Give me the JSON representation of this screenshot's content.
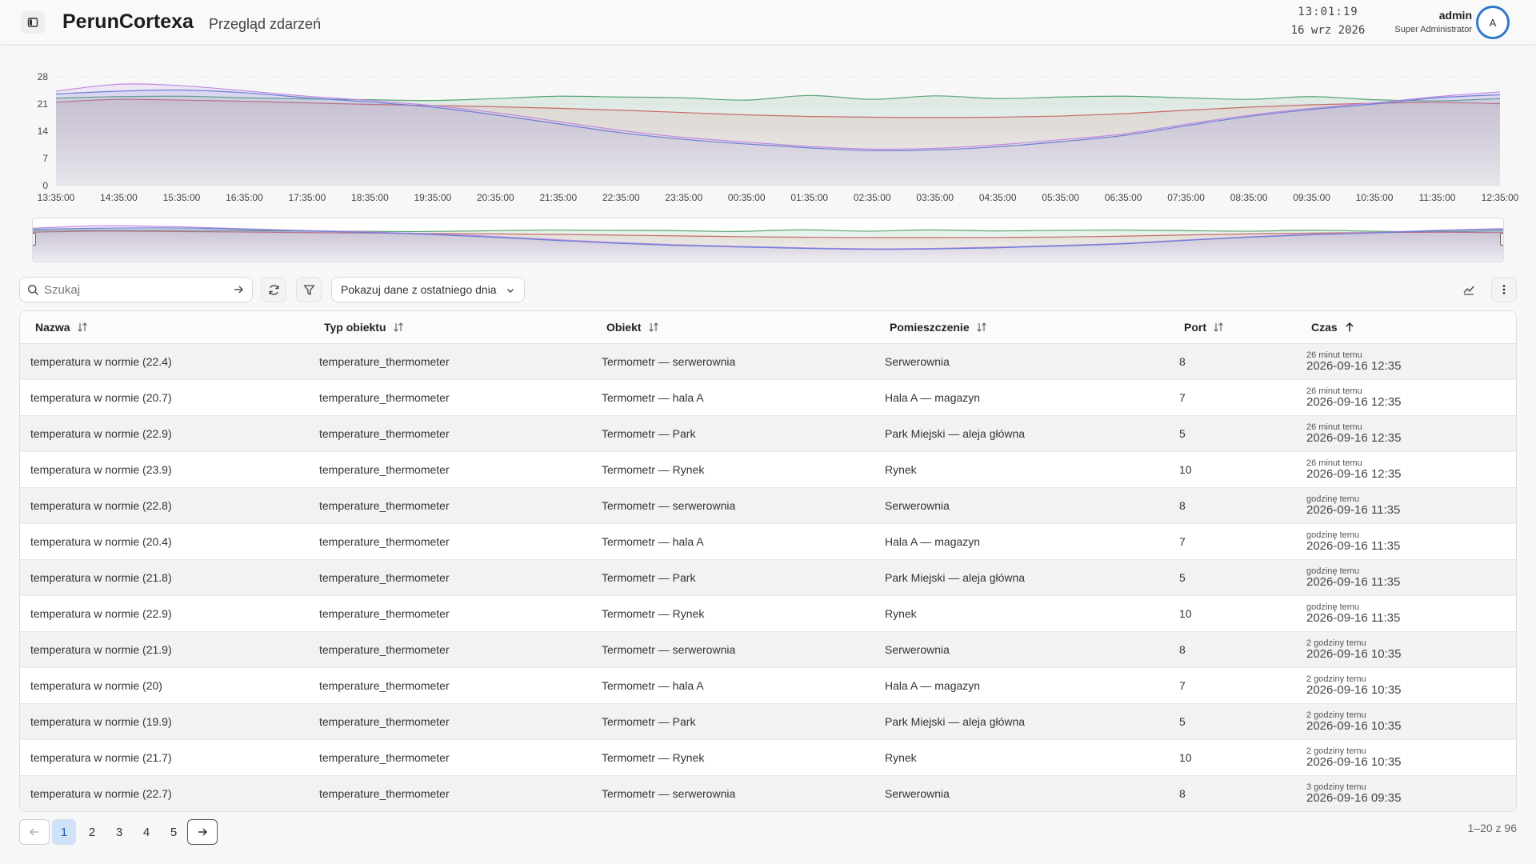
{
  "header": {
    "app_title": "PerunCortexa",
    "page_subtitle": "Przegląd zdarzeń",
    "time": "13:01:19",
    "date": "16 wrz 2026",
    "user_name": "admin",
    "user_role": "Super Administrator",
    "avatar_letter": "A"
  },
  "chart_data": {
    "type": "area",
    "title": "",
    "xlabel": "",
    "ylabel": "",
    "ylim": [
      0,
      28
    ],
    "yticks": [
      0,
      7,
      14,
      21,
      28
    ],
    "grid": "horizontal",
    "categories": [
      "13:35:00",
      "14:35:00",
      "15:35:00",
      "16:35:00",
      "17:35:00",
      "18:35:00",
      "19:35:00",
      "20:35:00",
      "21:35:00",
      "22:35:00",
      "23:35:00",
      "00:35:00",
      "01:35:00",
      "02:35:00",
      "03:35:00",
      "04:35:00",
      "05:35:00",
      "06:35:00",
      "07:35:00",
      "08:35:00",
      "09:35:00",
      "10:35:00",
      "11:35:00",
      "12:35:00"
    ],
    "series": [
      {
        "color": "#5aa576",
        "values": [
          22.5,
          22.9,
          23.0,
          22.6,
          22.3,
          22.1,
          21.9,
          22.4,
          23.0,
          22.8,
          22.6,
          22.0,
          23.2,
          22.2,
          23.1,
          22.4,
          22.8,
          23.0,
          22.6,
          22.2,
          22.9,
          22.1,
          21.8,
          22.4
        ]
      },
      {
        "color": "#c66a6a",
        "values": [
          21.5,
          22.2,
          22.0,
          21.7,
          21.3,
          20.9,
          20.6,
          20.3,
          19.9,
          19.4,
          18.8,
          18.2,
          17.8,
          17.6,
          17.5,
          17.6,
          17.9,
          18.5,
          19.4,
          20.2,
          20.8,
          21.2,
          21.4,
          21.1
        ]
      },
      {
        "color": "#c08be0",
        "values": [
          24.3,
          26.1,
          25.7,
          24.4,
          23.0,
          21.9,
          20.6,
          18.8,
          16.5,
          14.2,
          12.4,
          11.2,
          10.1,
          9.4,
          9.6,
          10.5,
          11.8,
          13.3,
          15.8,
          18.1,
          19.9,
          21.3,
          22.9,
          24.1
        ]
      },
      {
        "color": "#6b7fd6",
        "values": [
          23.6,
          24.3,
          24.6,
          23.9,
          22.6,
          21.5,
          20.2,
          18.2,
          15.9,
          13.6,
          11.9,
          10.7,
          9.7,
          9.0,
          9.2,
          10.0,
          11.3,
          12.9,
          15.4,
          17.8,
          19.6,
          21.0,
          22.6,
          23.4
        ]
      }
    ]
  },
  "toolbar": {
    "search_placeholder": "Szukaj",
    "range_label": "Pokazuj dane z ostatniego dnia"
  },
  "table": {
    "columns": [
      "Nazwa",
      "Typ obiektu",
      "Obiekt",
      "Pomieszczenie",
      "Port",
      "Czas"
    ],
    "rows": [
      {
        "name": "temperatura w normie (22.4)",
        "type": "temperature_thermometer",
        "object": "Termometr — serwerownia",
        "room": "Serwerownia",
        "port": "8",
        "rel": "26 minut temu",
        "abs": "2026-09-16 12:35"
      },
      {
        "name": "temperatura w normie (20.7)",
        "type": "temperature_thermometer",
        "object": "Termometr — hala A",
        "room": "Hala A — magazyn",
        "port": "7",
        "rel": "26 minut temu",
        "abs": "2026-09-16 12:35"
      },
      {
        "name": "temperatura w normie (22.9)",
        "type": "temperature_thermometer",
        "object": "Termometr — Park",
        "room": "Park Miejski — aleja główna",
        "port": "5",
        "rel": "26 minut temu",
        "abs": "2026-09-16 12:35"
      },
      {
        "name": "temperatura w normie (23.9)",
        "type": "temperature_thermometer",
        "object": "Termometr — Rynek",
        "room": "Rynek",
        "port": "10",
        "rel": "26 minut temu",
        "abs": "2026-09-16 12:35"
      },
      {
        "name": "temperatura w normie (22.8)",
        "type": "temperature_thermometer",
        "object": "Termometr — serwerownia",
        "room": "Serwerownia",
        "port": "8",
        "rel": "godzinę temu",
        "abs": "2026-09-16 11:35"
      },
      {
        "name": "temperatura w normie (20.4)",
        "type": "temperature_thermometer",
        "object": "Termometr — hala A",
        "room": "Hala A — magazyn",
        "port": "7",
        "rel": "godzinę temu",
        "abs": "2026-09-16 11:35"
      },
      {
        "name": "temperatura w normie (21.8)",
        "type": "temperature_thermometer",
        "object": "Termometr — Park",
        "room": "Park Miejski — aleja główna",
        "port": "5",
        "rel": "godzinę temu",
        "abs": "2026-09-16 11:35"
      },
      {
        "name": "temperatura w normie (22.9)",
        "type": "temperature_thermometer",
        "object": "Termometr — Rynek",
        "room": "Rynek",
        "port": "10",
        "rel": "godzinę temu",
        "abs": "2026-09-16 11:35"
      },
      {
        "name": "temperatura w normie (21.9)",
        "type": "temperature_thermometer",
        "object": "Termometr — serwerownia",
        "room": "Serwerownia",
        "port": "8",
        "rel": "2 godziny temu",
        "abs": "2026-09-16 10:35"
      },
      {
        "name": "temperatura w normie (20)",
        "type": "temperature_thermometer",
        "object": "Termometr — hala A",
        "room": "Hala A — magazyn",
        "port": "7",
        "rel": "2 godziny temu",
        "abs": "2026-09-16 10:35"
      },
      {
        "name": "temperatura w normie (19.9)",
        "type": "temperature_thermometer",
        "object": "Termometr — Park",
        "room": "Park Miejski — aleja główna",
        "port": "5",
        "rel": "2 godziny temu",
        "abs": "2026-09-16 10:35"
      },
      {
        "name": "temperatura w normie (21.7)",
        "type": "temperature_thermometer",
        "object": "Termometr — Rynek",
        "room": "Rynek",
        "port": "10",
        "rel": "2 godziny temu",
        "abs": "2026-09-16 10:35"
      },
      {
        "name": "temperatura w normie (22.7)",
        "type": "temperature_thermometer",
        "object": "Termometr — serwerownia",
        "room": "Serwerownia",
        "port": "8",
        "rel": "3 godziny temu",
        "abs": "2026-09-16 09:35"
      }
    ]
  },
  "pagination": {
    "pages": [
      "1",
      "2",
      "3",
      "4",
      "5"
    ],
    "current_page": "1",
    "summary": "1–20 z 96"
  },
  "icons": {
    "sidebar_toggle": "sidebar-toggle-icon",
    "search": "search-icon",
    "submit": "arrow-right-icon",
    "refresh": "refresh-icon",
    "filter": "filter-icon",
    "chevron": "chevron-down-icon",
    "chart_toggle": "chart-icon",
    "more": "more-vertical-icon",
    "sort": "sort-icon",
    "sort_asc": "sort-ascending-icon"
  }
}
